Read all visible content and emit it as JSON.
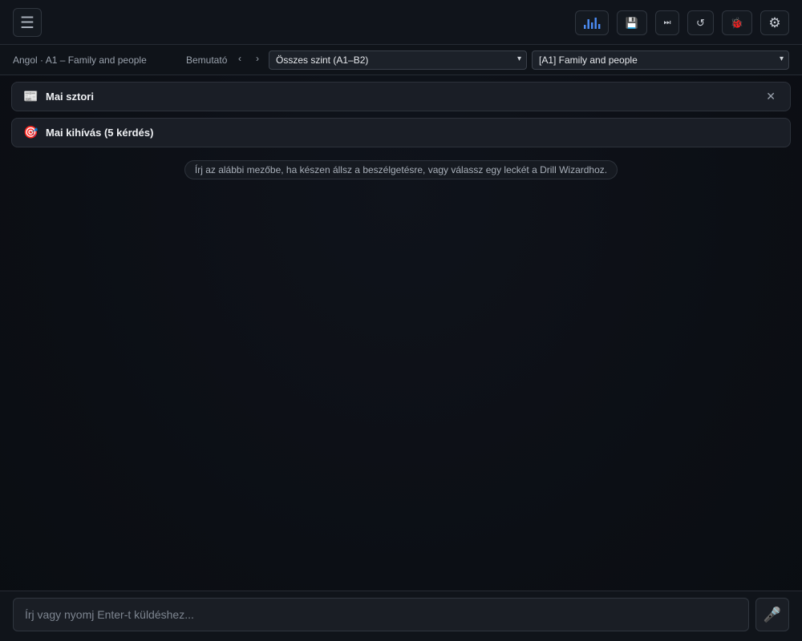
{
  "topbar": {
    "menu_icon": "hamburger-icon",
    "buttons": [
      {
        "name": "stats-button",
        "icon": "bar-chart-icon"
      },
      {
        "name": "save-button",
        "icon": "floppy-disk-icon"
      },
      {
        "name": "skip-button",
        "icon": "skip-forward-icon"
      },
      {
        "name": "reset-button",
        "icon": "refresh-icon"
      },
      {
        "name": "debug-button",
        "icon": "bug-icon"
      },
      {
        "name": "settings-button",
        "icon": "gear-icon"
      }
    ]
  },
  "subbar": {
    "breadcrumb": "Angol · A1 – Family and people",
    "demo_label": "Bemutató",
    "prev": "‹",
    "next": "›",
    "level_select": "Összes szint (A1–B2)",
    "lesson_select": "[A1] Family and people"
  },
  "cards": {
    "story_title": "Mai sztori",
    "story_icon": "newspaper-icon",
    "close": "✕",
    "challenge_title": "Mai kihívás (5 kérdés)",
    "challenge_icon": "target-icon"
  },
  "hint": "Írj az alábbi mezőbe, ha készen állsz a beszélgetésre, vagy válassz egy leckét a Drill Wizardhoz.",
  "composer": {
    "placeholder": "Írj vagy nyomj Enter-t küldéshez...",
    "mic_icon": "microphone-icon"
  },
  "colors": {
    "accent": "#4c8df6",
    "background": "#0c0f15"
  }
}
